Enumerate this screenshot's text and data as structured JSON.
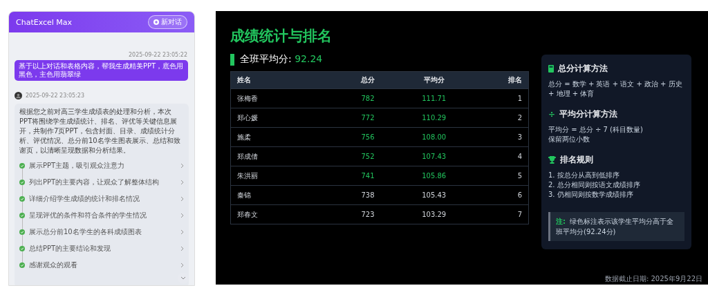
{
  "chat": {
    "title": "ChatExcel Max",
    "new_chat_button": "新对话",
    "messages": [
      {
        "kind": "user",
        "time": "2025-09-22 23:05:22",
        "text": "基于以上对话和表格内容，帮我生成精美PPT，底色用黑色，主色用翡翠绿"
      },
      {
        "kind": "assistant",
        "time": "2025-09-22 23:05:23",
        "text": "根据您之前对高三学生成绩表的处理和分析，本次PPT将围绕学生成绩统计、排名、评优等关键信息展开，共制作7页PPT，包含封面、目录、成绩统计分析、评优情况、总分前10名学生图表展示、总结和致谢页，以清晰呈现数据和分析结果。",
        "steps": [
          {
            "text": "展示PPT主题，吸引观众注意力",
            "done": true
          },
          {
            "text": "列出PPT的主要内容，让观众了解整体结构",
            "done": true
          },
          {
            "text": "详细介绍学生成绩的统计和排名情况",
            "done": true
          },
          {
            "text": "呈现评优的条件和符合条件的学生情况",
            "done": true
          },
          {
            "text": "展示总分前10名学生的各科成绩图表",
            "done": true
          },
          {
            "text": "总结PPT的主要结论和发现",
            "done": true
          },
          {
            "text": "感谢观众的观看",
            "done": true
          }
        ]
      }
    ]
  },
  "slide": {
    "title": "成绩统计与排名",
    "average_label": "全班平均分:",
    "average_value": "92.24",
    "table": {
      "columns": [
        "姓名",
        "总分",
        "平均分",
        "排名"
      ],
      "rows": [
        {
          "cells": [
            "张梅香",
            "782",
            "111.71",
            "1"
          ],
          "highlight": true
        },
        {
          "cells": [
            "郑心媛",
            "772",
            "110.29",
            "2"
          ],
          "highlight": true
        },
        {
          "cells": [
            "施柔",
            "756",
            "108.00",
            "3"
          ],
          "highlight": true
        },
        {
          "cells": [
            "郑成倩",
            "752",
            "107.43",
            "4"
          ],
          "highlight": true
        },
        {
          "cells": [
            "朱洪丽",
            "741",
            "105.86",
            "5"
          ],
          "highlight": true
        },
        {
          "cells": [
            "秦锦",
            "738",
            "105.43",
            "6"
          ],
          "highlight": false
        },
        {
          "cells": [
            "郑春文",
            "723",
            "103.29",
            "7"
          ],
          "highlight": false
        }
      ]
    },
    "info": {
      "sections": [
        {
          "kind": "calculator",
          "title": "总分计算方法",
          "lines": [
            "总分 = 数学 + 英语 + 语文 + 政治 + 历史 + 地理 + 体育"
          ]
        },
        {
          "kind": "divide",
          "icon": "÷",
          "title": "平均分计算方法",
          "lines": [
            "平均分 = 总分 ÷ 7 (科目数量)",
            "保留两位小数"
          ]
        },
        {
          "kind": "trophy",
          "title": "排名规则",
          "lines": [
            "1. 按总分从高到低排序",
            "2. 总分相同则按语文成绩排序",
            "3. 仍相同则按数学成绩排序"
          ]
        }
      ],
      "note": {
        "label": "注:",
        "text": "绿色标注表示该学生平均分高于全班平均分(92.24分)"
      }
    },
    "footer": "数据截止日期: 2025年9月22日"
  }
}
